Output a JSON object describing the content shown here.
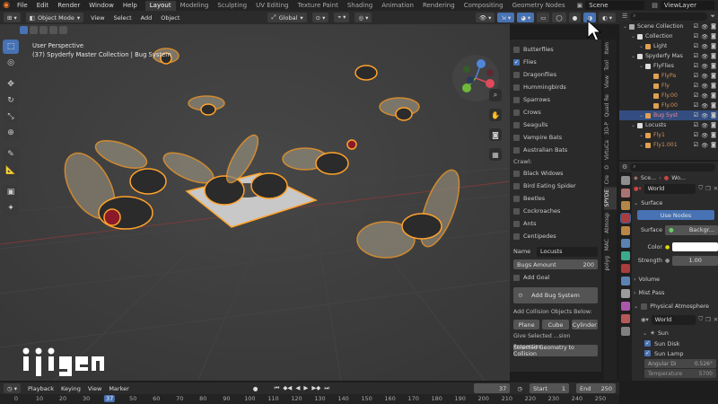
{
  "menu": [
    "File",
    "Edit",
    "Render",
    "Window",
    "Help"
  ],
  "workspaces": [
    "Layout",
    "Modeling",
    "Sculpting",
    "UV Editing",
    "Texture Paint",
    "Shading",
    "Animation",
    "Rendering",
    "Compositing",
    "Geometry Nodes"
  ],
  "scene": "Scene",
  "view_layer": "ViewLayer",
  "viewport_header": {
    "mode": "Object Mode",
    "menus": [
      "View",
      "Select",
      "Add",
      "Object"
    ],
    "orientation": "Global"
  },
  "viewport": {
    "info_line1": "User Perspective",
    "info_line2": "(37) Spyderfy Master Collection | Bug System",
    "watermark": "ijigen"
  },
  "bug_panel": {
    "fly_items": [
      {
        "label": "Butterflies",
        "checked": false
      },
      {
        "label": "Flies",
        "checked": true
      },
      {
        "label": "Dragonflies",
        "checked": false
      },
      {
        "label": "Hummingbirds",
        "checked": false
      },
      {
        "label": "Sparrows",
        "checked": false
      },
      {
        "label": "Crows",
        "checked": false
      },
      {
        "label": "Seagulls",
        "checked": false
      },
      {
        "label": "Vampire Bats",
        "checked": false
      },
      {
        "label": "Australian Bats",
        "checked": false
      }
    ],
    "crawl_label": "Crawl:",
    "crawl_items": [
      {
        "label": "Black Widows",
        "checked": false
      },
      {
        "label": "Bird Eating Spider",
        "checked": false
      },
      {
        "label": "Beetles",
        "checked": false
      },
      {
        "label": "Cockroaches",
        "checked": false
      },
      {
        "label": "Ants",
        "checked": false
      },
      {
        "label": "Centipedes",
        "checked": false
      }
    ],
    "name_label": "Name",
    "name_value": "Locusts",
    "amount_label": "Bugs Amount",
    "amount_value": "200",
    "add_goal": "Add Goal",
    "add_bug_system": "Add Bug System",
    "collision_label": "Add Collision Objects Below:",
    "collision_buttons": [
      "Plane",
      "Cube",
      "Cylinder"
    ],
    "give_selected": "Give Selected ...sion Properties:",
    "selected_geometry": "Selected Geometry to Collision"
  },
  "vertical_tabs": [
    "Item",
    "Tool",
    "View",
    "Quad Re",
    "3D-P",
    "VirtuCa",
    "O",
    "Cre",
    "SPYDE",
    "Atmosp",
    "MAC",
    "polyg"
  ],
  "outliner": {
    "rows": [
      {
        "label": "Scene Collection",
        "indent": 0,
        "selected": false
      },
      {
        "label": "Collection",
        "indent": 1,
        "selected": false
      },
      {
        "label": "Light",
        "indent": 2,
        "selected": false
      },
      {
        "label": "Spyderfy Mas",
        "indent": 1,
        "selected": false
      },
      {
        "label": "FlyFlies",
        "indent": 2,
        "selected": false
      },
      {
        "label": "FlyPa",
        "indent": 3,
        "selected": false
      },
      {
        "label": "Fly",
        "indent": 3,
        "selected": false
      },
      {
        "label": "Fly.00",
        "indent": 3,
        "selected": false
      },
      {
        "label": "Fly.00",
        "indent": 3,
        "selected": false
      },
      {
        "label": "Bug Syst",
        "indent": 2,
        "selected": true
      },
      {
        "label": "Locusts",
        "indent": 1,
        "selected": false
      },
      {
        "label": "Fly1",
        "indent": 2,
        "selected": false
      },
      {
        "label": "Fly1.001",
        "indent": 2,
        "selected": false
      }
    ]
  },
  "properties": {
    "breadcrumb_scene": "Sce...",
    "breadcrumb_world": "Wo...",
    "world_name": "World",
    "surface_header": "Surface",
    "use_nodes": "Use Nodes",
    "surface_label": "Surface",
    "surface_value": "Backgr...",
    "color_label": "Color",
    "strength_label": "Strength",
    "strength_value": "1.00",
    "volume": "Volume",
    "mist_pass": "Mist Pass",
    "physical_atmosphere": "Physical Atmosphere",
    "pa_world": "World",
    "sun": "Sun",
    "sun_disk": "Sun Disk",
    "sun_lamp": "Sun Lamp",
    "angular_label": "Angular Di",
    "angular_value": "0.526°",
    "temperature_label": "Temperature",
    "temperature_value": "5700"
  },
  "timeline": {
    "menus": [
      "Playback",
      "Keying",
      "View",
      "Marker"
    ],
    "current_frame": "37",
    "start_label": "Start",
    "start_value": "1",
    "end_label": "End",
    "end_value": "250",
    "ruler": [
      "0",
      "10",
      "20",
      "30",
      "37",
      "50",
      "60",
      "70",
      "80",
      "90",
      "100",
      "110",
      "120",
      "130",
      "140",
      "150",
      "160",
      "170",
      "180",
      "190",
      "200",
      "210",
      "220",
      "230",
      "240",
      "250"
    ]
  },
  "colors": {
    "accent": "#4772b3",
    "selection_orange": "#ffa22b",
    "panel": "#2a2a2a"
  }
}
